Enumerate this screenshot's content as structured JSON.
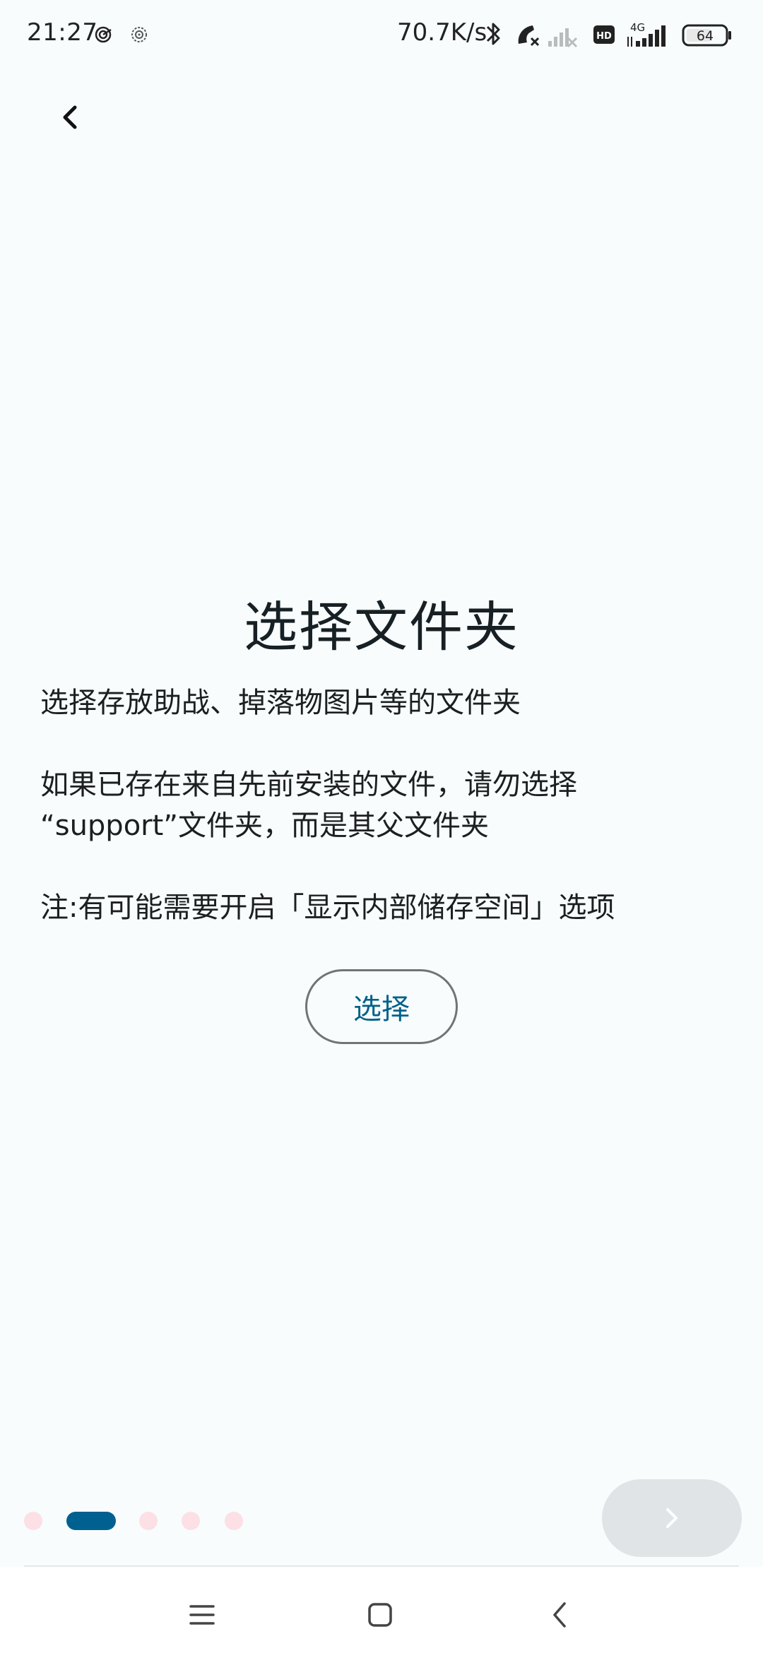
{
  "status_bar": {
    "time": "21:27",
    "net_speed": "70.7K/s",
    "network_type": "4G",
    "hd_label": "HD",
    "battery_level": "64",
    "icons": [
      "radar-icon",
      "radar-outline-icon",
      "bluetooth-icon",
      "call-off-icon",
      "signal-off-icon",
      "hd-icon",
      "signal-4g-icon",
      "battery-icon"
    ]
  },
  "header": {
    "back_icon": "chevron-left-icon"
  },
  "content": {
    "title": "选择文件夹",
    "paragraph_1": "选择存放助战、掉落物图片等的文件夹",
    "paragraph_2_line_1": "如果已存在来自先前安装的文件，请勿选择",
    "paragraph_2_line_2": "“support”文件夹，而是其父文件夹",
    "note": "注:有可能需要开启「显示内部储存空间」选项",
    "select_button_label": "选择"
  },
  "pager": {
    "total_pages": 5,
    "current_page": 2,
    "active_color": "#00608f",
    "inactive_color": "#fce0e6",
    "next_icon": "chevron-right-icon"
  },
  "nav_bar": {
    "icons": [
      "menu-icon",
      "home-square-icon",
      "back-chevron-icon"
    ]
  }
}
